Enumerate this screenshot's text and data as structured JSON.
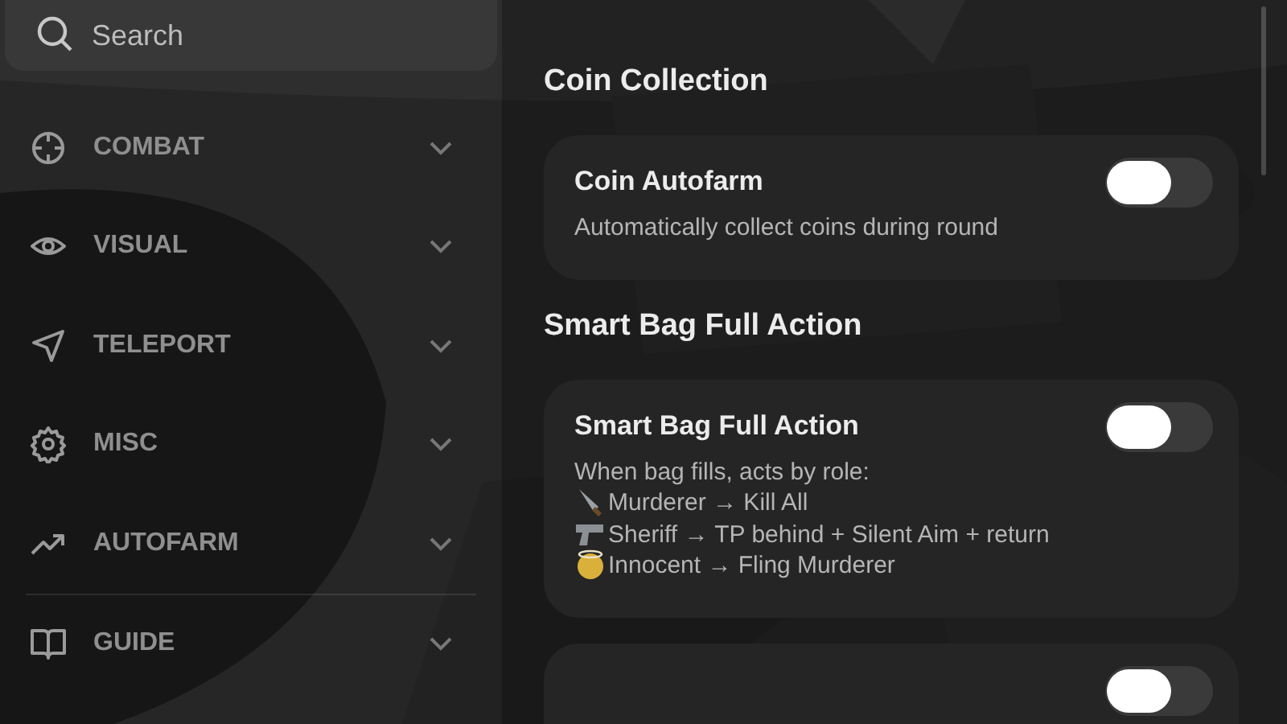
{
  "search": {
    "placeholder": "Search"
  },
  "sidebar": {
    "items": [
      {
        "label": "COMBAT",
        "expanded": false
      },
      {
        "label": "VISUAL",
        "expanded": false
      },
      {
        "label": "TELEPORT",
        "expanded": false
      },
      {
        "label": "MISC",
        "expanded": false
      },
      {
        "label": "AUTOFARM",
        "expanded": false
      },
      {
        "label": "GUIDE",
        "expanded": false
      }
    ]
  },
  "sections": [
    {
      "heading": "Coin Collection",
      "settings": [
        {
          "title": "Coin Autofarm",
          "description": [
            {
              "kind": "intro",
              "text": "Automatically collect coins during round"
            }
          ],
          "on": false
        }
      ]
    },
    {
      "heading": "Smart Bag Full Action",
      "settings": [
        {
          "title": "Smart Bag Full Action",
          "description": [
            {
              "kind": "intro",
              "text": "When bag fills, acts by role:"
            },
            {
              "kind": "role",
              "text": "Murderer → Kill All"
            },
            {
              "kind": "role",
              "text": "Sheriff → TP behind + Silent Aim + return"
            },
            {
              "kind": "role",
              "text": "Innocent → Fling Murderer"
            }
          ],
          "on": false
        },
        {
          "on": false
        }
      ]
    }
  ]
}
